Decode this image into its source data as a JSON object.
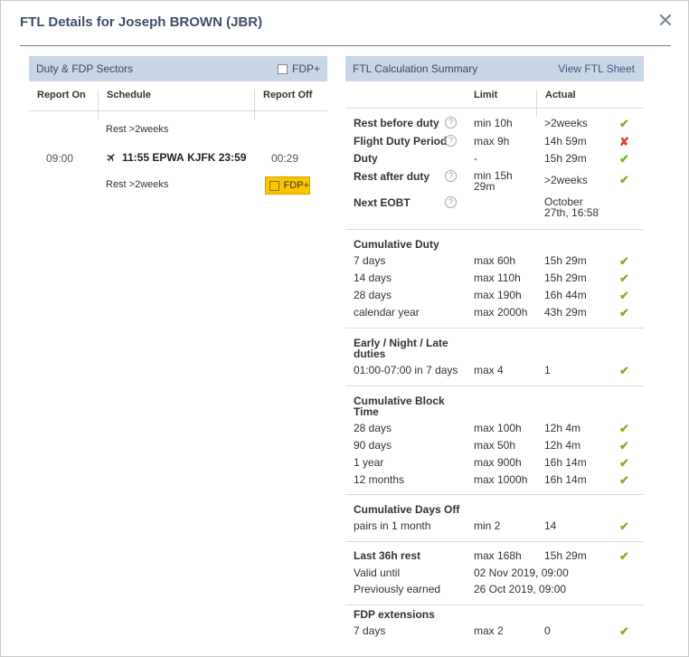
{
  "dialog": {
    "title": "FTL Details for Joseph BROWN (JBR)",
    "close_icon": "close-icon"
  },
  "duty": {
    "title": "Duty & FDP Sectors",
    "fdp_label": "FDP+",
    "columns": [
      "Report On",
      "Schedule",
      "Report Off"
    ],
    "rest_before": "Rest >2weeks",
    "report_on": "09:00",
    "flight": {
      "dep_time": "11:55",
      "from": "EPWA",
      "to": "KJFK",
      "arr_time": "23:59"
    },
    "report_off": "00:29",
    "rest_after": "Rest >2weeks",
    "fdp_button": "FDP+"
  },
  "summary": {
    "title": "FTL Calculation Summary",
    "link": "View FTL Sheet",
    "columns": {
      "limit": "Limit",
      "actual": "Actual"
    },
    "primary": [
      {
        "label": "Rest before duty",
        "help": true,
        "limit": "min 10h",
        "actual": ">2weeks",
        "status": "ok"
      },
      {
        "label": "Flight Duty Period",
        "help": true,
        "limit": "max 9h",
        "actual": "14h 59m",
        "status": "bad"
      },
      {
        "label": "Duty",
        "help": false,
        "limit": "-",
        "actual": "15h 29m",
        "status": "ok"
      },
      {
        "label": "Rest after duty",
        "help": true,
        "limit": "min 15h 29m",
        "actual": ">2weeks",
        "status": "ok"
      },
      {
        "label": "Next EOBT",
        "help": true,
        "limit": "",
        "actual": "October 27th, 16:58",
        "status": ""
      }
    ],
    "cumulative_duty": {
      "title": "Cumulative Duty",
      "rows": [
        {
          "label": "7 days",
          "limit": "max 60h",
          "actual": "15h 29m",
          "status": "ok"
        },
        {
          "label": "14 days",
          "limit": "max 110h",
          "actual": "15h 29m",
          "status": "ok"
        },
        {
          "label": "28 days",
          "limit": "max 190h",
          "actual": "16h 44m",
          "status": "ok"
        },
        {
          "label": "calendar year",
          "limit": "max 2000h",
          "actual": "43h 29m",
          "status": "ok"
        }
      ]
    },
    "early_night": {
      "title": "Early / Night / Late duties",
      "rows": [
        {
          "label": "01:00-07:00 in 7 days",
          "limit": "max 4",
          "actual": "1",
          "status": "ok"
        }
      ]
    },
    "block_time": {
      "title": "Cumulative Block Time",
      "rows": [
        {
          "label": "28 days",
          "limit": "max 100h",
          "actual": "12h 4m",
          "status": "ok"
        },
        {
          "label": "90 days",
          "limit": "max 50h",
          "actual": "12h 4m",
          "status": "ok"
        },
        {
          "label": "1 year",
          "limit": "max 900h",
          "actual": "16h 14m",
          "status": "ok"
        },
        {
          "label": "12 months",
          "limit": "max 1000h",
          "actual": "16h 14m",
          "status": "ok"
        }
      ]
    },
    "days_off": {
      "title": "Cumulative Days Off",
      "rows": [
        {
          "label": "pairs in 1 month",
          "limit": "min 2",
          "actual": "14",
          "status": "ok"
        }
      ]
    },
    "last_rest": {
      "title": "Last 36h rest",
      "limit": "max 168h",
      "actual": "15h 29m",
      "status": "ok",
      "valid_label": "Valid until",
      "valid_value": "02 Nov 2019, 09:00",
      "earned_label": "Previously earned",
      "earned_value": "26 Oct 2019, 09:00"
    },
    "fdp_ext": {
      "title": "FDP extensions",
      "rows": [
        {
          "label": "7 days",
          "limit": "max 2",
          "actual": "0",
          "status": "ok"
        }
      ]
    }
  },
  "colors": {
    "header_bg": "#c8d6e8",
    "ok": "#7ab51d",
    "bad": "#e0402c",
    "highlight": "#f9c600"
  }
}
